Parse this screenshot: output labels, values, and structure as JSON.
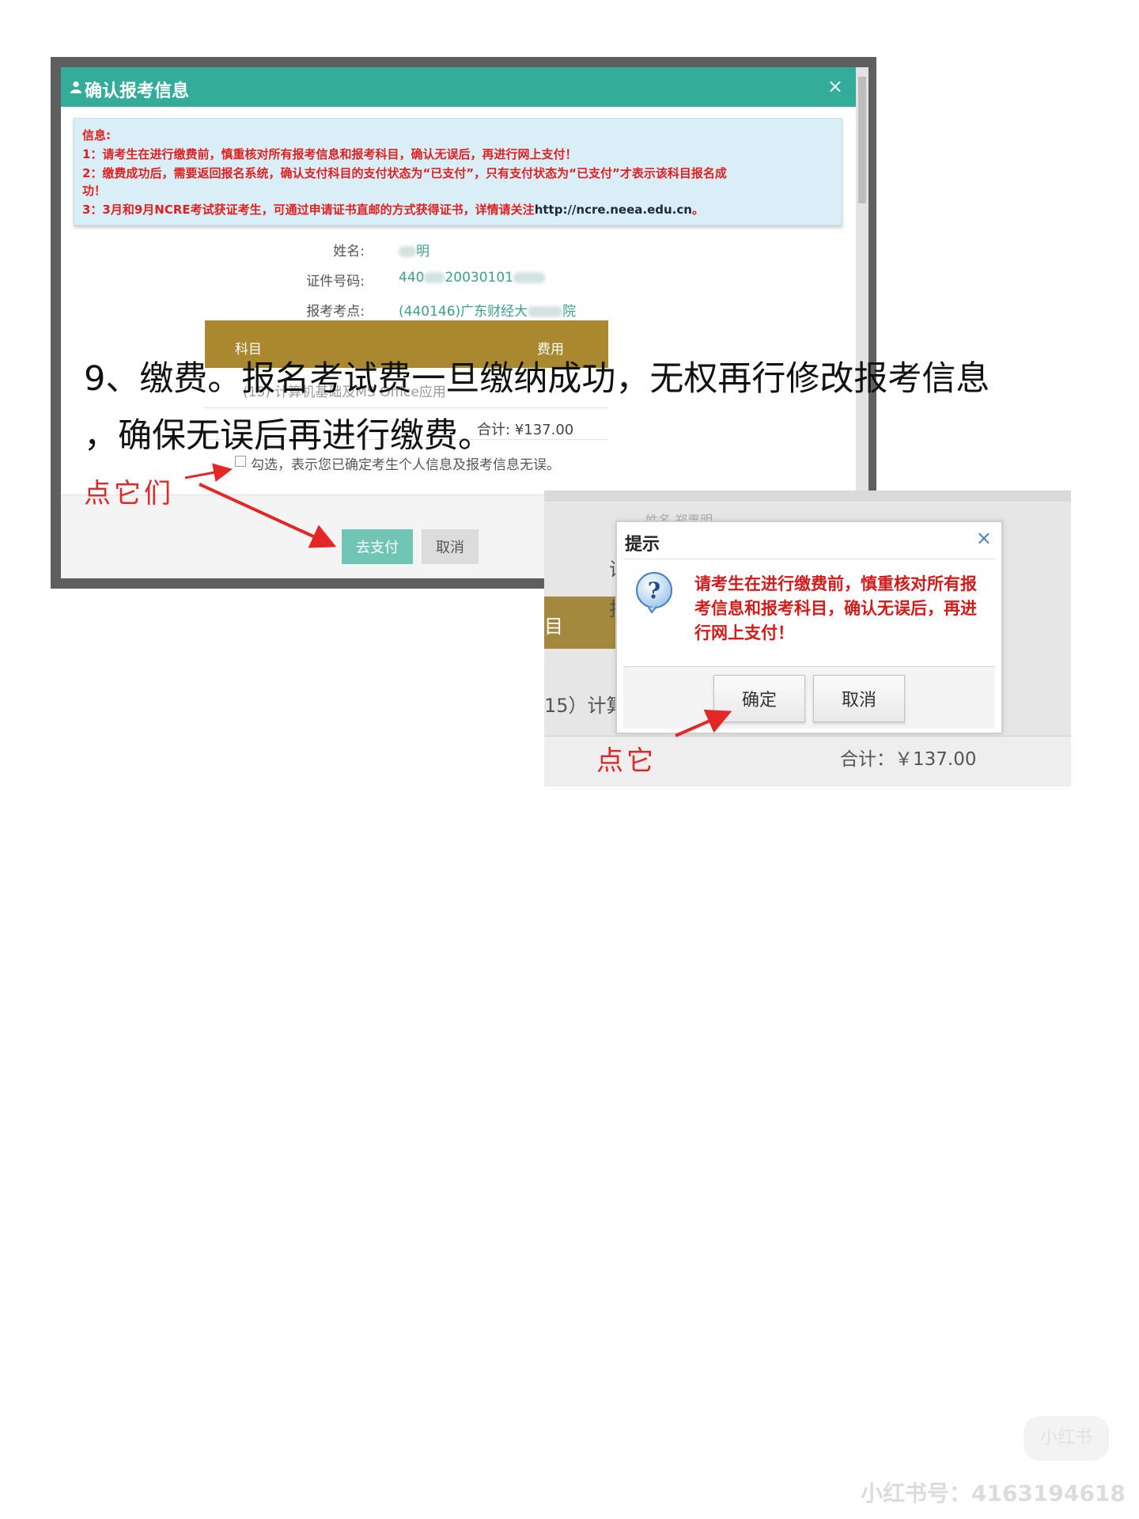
{
  "step_heading": {
    "line1": "9、缴费。报名考试费一旦缴纳成功，无权再行修改报考信息",
    "line2": "，确保无误后再进行缴费。"
  },
  "confirm_dialog": {
    "title": "确认报考信息",
    "close_glyph": "×",
    "info": {
      "label": "信息:",
      "line1": "1：请考生在进行缴费前，慎重核对所有报考信息和报考科目，确认无误后，再进行网上支付！",
      "line2": "2：缴费成功后，需要返回报名系统，确认支付科目的支付状态为“已支付”，只有支付状态为“已支付”才表示该科目报名成",
      "line2b": "功！",
      "line3_prefix": "3：3月和9月NCRE考试获证考生，可通过申请证书直邮的方式获得证书，详情请关注",
      "line3_url": "http://ncre.neea.edu.cn",
      "line3_suffix": "。"
    },
    "fields": {
      "name_label": "姓名:",
      "name_value": "明",
      "id_label": "证件号码:",
      "id_value_a": "440",
      "id_value_b": "20030101",
      "site_label": "报考考点:",
      "site_value": "(440146)广东财经大",
      "site_value_end": "院"
    },
    "table": {
      "col_subject": "科目",
      "col_fee": "费用",
      "row_text": "(15) 计算机基础及MS Office应用",
      "total": "合计: ¥137.00"
    },
    "agree_label": "勾选，表示您已确定考生个人信息及报考信息无误。",
    "agree_checked": false,
    "pay_button": "去支付",
    "cancel_button": "取消"
  },
  "annotation1": "点它们",
  "prompt_dialog": {
    "bg_ghost": "姓名    郑惠明",
    "bg_gold_label": "目",
    "bg_side_1": "证",
    "bg_side_2": "报",
    "bg_row_text": "15）计算",
    "bg_total": "合计：￥137.00",
    "title": "提示",
    "close_glyph": "×",
    "message_line1": "请考生在进行缴费前，慎重核对所有报",
    "message_line2": "考信息和报考科目，确认无误后，再进",
    "message_line3": "行网上支付！",
    "ok_button": "确定",
    "cancel_button": "取消"
  },
  "annotation2": "点它",
  "watermark": {
    "logo": "小红书",
    "account": "小红书号：4163194618"
  },
  "colors": {
    "header_teal": "#33ad9a",
    "info_red": "#e02121",
    "table_gold": "#a9882f",
    "annotation_red": "#e32626"
  }
}
